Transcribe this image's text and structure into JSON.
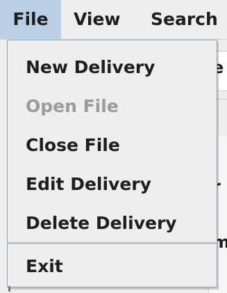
{
  "menubar": {
    "items": [
      {
        "label": "File",
        "active": true
      },
      {
        "label": "View"
      },
      {
        "label": "Search"
      }
    ]
  },
  "file_menu": {
    "items": [
      {
        "label": "New Delivery",
        "enabled": true
      },
      {
        "label": "Open File",
        "enabled": false
      },
      {
        "label": "Close File",
        "enabled": true
      },
      {
        "label": "Edit Delivery",
        "enabled": true
      },
      {
        "label": "Delete Delivery",
        "enabled": true
      },
      {
        "label": "Exit",
        "enabled": true
      }
    ]
  },
  "background": {
    "partial_glyphs": [
      "e",
      "r",
      "m"
    ]
  },
  "colors": {
    "menu_highlight": "#b8cfe5",
    "disabled_text": "#9b9b9b",
    "text": "#1e1e1e",
    "background": "#eeeeee"
  }
}
